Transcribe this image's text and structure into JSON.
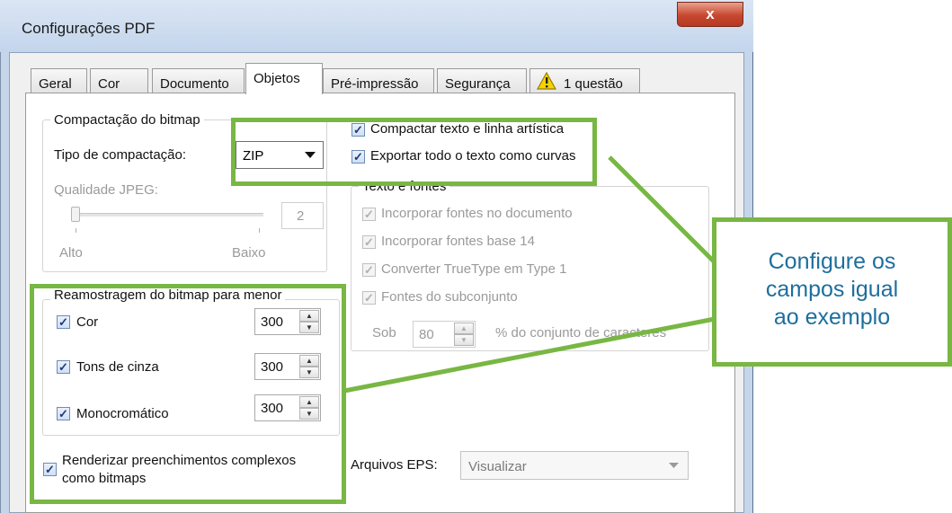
{
  "window": {
    "title": "Configurações PDF",
    "close_label": "x"
  },
  "tabs": [
    {
      "label": "Geral"
    },
    {
      "label": "Cor"
    },
    {
      "label": "Documento"
    },
    {
      "label": "Objetos",
      "active": true
    },
    {
      "label": "Pré-impressão"
    },
    {
      "label": "Segurança"
    },
    {
      "label": "1 questão",
      "icon": "warning-icon"
    }
  ],
  "bitmap_compression": {
    "legend": "Compactação do bitmap",
    "type_label": "Tipo de compactação:",
    "type_value": "ZIP",
    "jpeg_quality_label": "Qualidade JPEG:",
    "jpeg_quality_value": "2",
    "slider_min_label": "Alto",
    "slider_max_label": "Baixo"
  },
  "options": {
    "compress_text_art": {
      "label": "Compactar texto e linha artística",
      "checked": true
    },
    "export_text_curves": {
      "label": "Exportar todo o texto como curvas",
      "checked": true
    }
  },
  "text_fonts": {
    "legend": "Texto e fontes",
    "embed_fonts": "Incorporar fontes no documento",
    "embed_base14": "Incorporar fontes base 14",
    "convert_truetype": "Converter TrueType em Type 1",
    "subset_fonts": "Fontes do subconjunto",
    "under_label": "Sob",
    "under_value": "80",
    "charset_label": "% do conjunto de caracteres"
  },
  "downsampling": {
    "legend": "Reamostragem do bitmap para menor",
    "rows": [
      {
        "label": "Cor",
        "value": "300",
        "checked": true
      },
      {
        "label": "Tons de cinza",
        "value": "300",
        "checked": true
      },
      {
        "label": "Monocromático",
        "value": "300",
        "checked": true
      }
    ]
  },
  "render_complex": {
    "line1": "Renderizar preenchimentos complexos",
    "line2": "como bitmaps",
    "checked": true
  },
  "eps": {
    "label": "Arquivos EPS:",
    "value": "Visualizar"
  },
  "callout": {
    "line1": "Configure os",
    "line2": "campos igual",
    "line3": "ao exemplo"
  },
  "colors": {
    "annotation_green": "#78b743",
    "callout_text": "#1d6e9e",
    "close_red": "#c7472f"
  }
}
